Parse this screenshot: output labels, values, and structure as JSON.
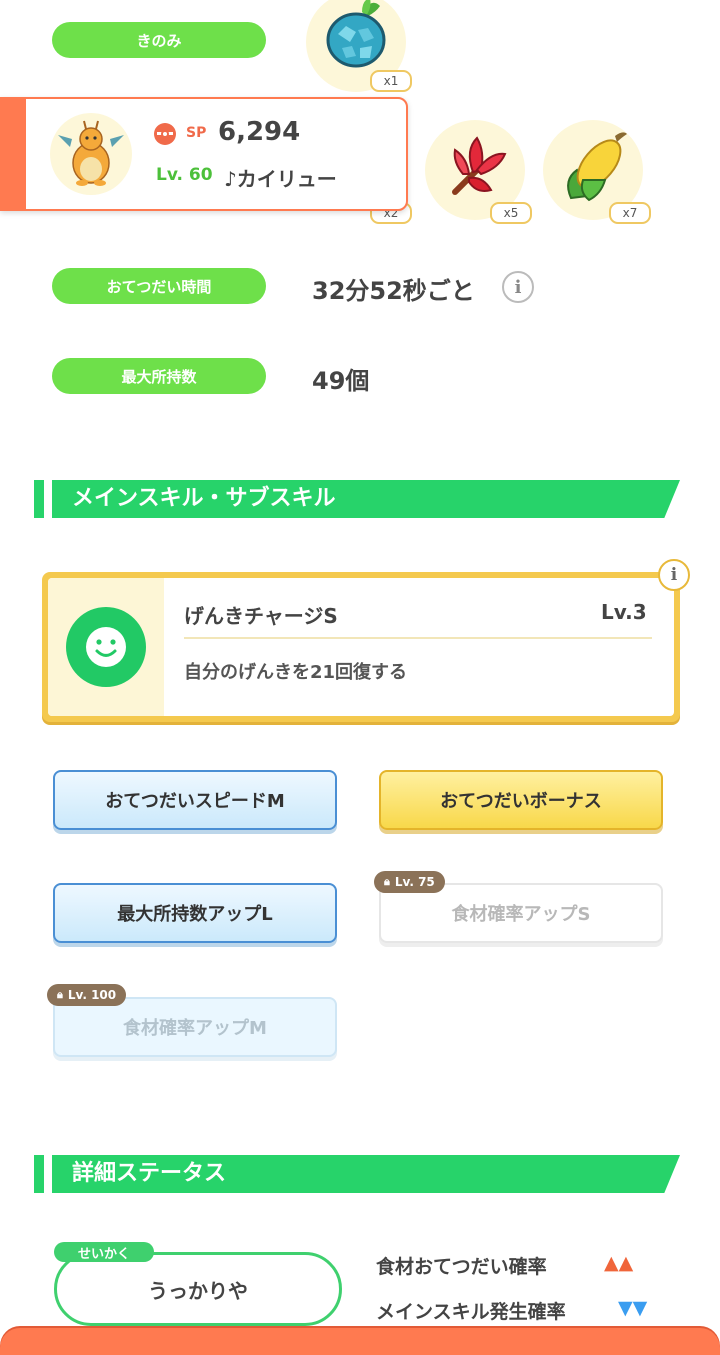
{
  "berry": {
    "label": "きのみ",
    "count": "x1"
  },
  "pokemon_card": {
    "sp_label": "SP",
    "sp_value": "6,294",
    "level": "Lv. 60",
    "name": "♪カイリュー",
    "hidden_count": "x2"
  },
  "ingredients": [
    {
      "name": "ingredient-leek",
      "count": "x5"
    },
    {
      "name": "ingredient-corn",
      "count": "x7"
    }
  ],
  "help_time": {
    "label": "おてつだい時間",
    "value": "32分52秒ごと"
  },
  "max_carry": {
    "label": "最大所持数",
    "value": "49個"
  },
  "skills_section": {
    "title": "メインスキル・サブスキル"
  },
  "main_skill": {
    "name": "げんきチャージS",
    "level": "Lv.3",
    "description": "自分のげんきを21回復する"
  },
  "sub_skills": [
    {
      "label": "おてつだいスピードM"
    },
    {
      "label": "おてつだいボーナス"
    },
    {
      "label": "最大所持数アップL"
    },
    {
      "label": "食材確率アップS",
      "lock_level": "Lv. 75"
    },
    {
      "label": "食材確率アップM",
      "lock_level": "Lv. 100"
    }
  ],
  "details_section": {
    "title": "詳細ステータス"
  },
  "nature": {
    "tag": "せいかく",
    "value": "うっかりや",
    "stats": [
      {
        "label": "食材おてつだい確率",
        "arrows": "▲▲",
        "color": "#f0653a"
      },
      {
        "label": "メインスキル発生確率",
        "arrows": "▼▼",
        "color": "#3a9df0"
      }
    ]
  },
  "colors": {
    "green": "#6ee04a",
    "section_green": "#27d36a",
    "orange": "#ff7a50",
    "gold": "#e8b93a"
  }
}
